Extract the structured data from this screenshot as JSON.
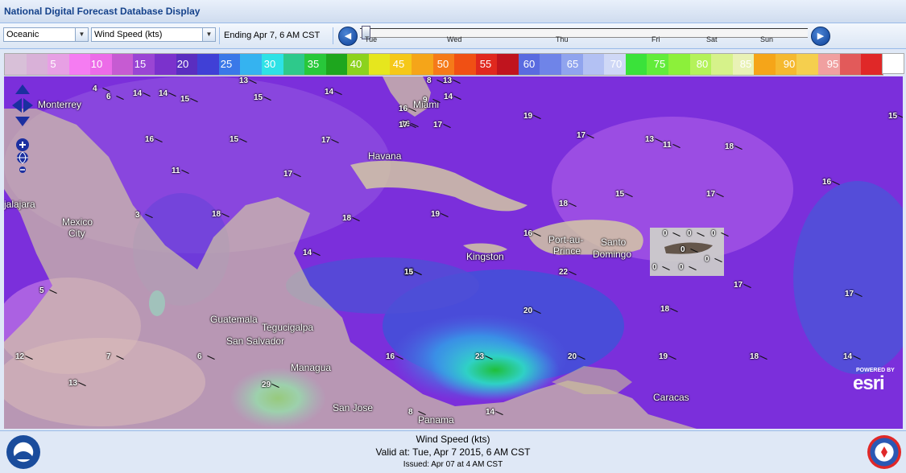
{
  "app": {
    "title": "National Digital Forecast Database Display"
  },
  "toolbar": {
    "region_select": "Oceanic",
    "element_select": "Wind Speed (kts)",
    "ending_label": "Ending Apr  7,  6 AM CST",
    "prev_icon": "step-back-icon",
    "next_icon": "step-forward-icon"
  },
  "timeline": {
    "days": [
      "Tue",
      "Wed",
      "Thu",
      "Fri",
      "Sat",
      "Sun"
    ],
    "position": 0.0
  },
  "legend": {
    "labels": [
      "5",
      "10",
      "15",
      "20",
      "25",
      "30",
      "35",
      "40",
      "45",
      "50",
      "55",
      "60",
      "65",
      "70",
      "75",
      "80",
      "85",
      "90",
      "95"
    ],
    "colors": [
      "#d8c0d8",
      "#d9b1d8",
      "#e7a0e4",
      "#f57cf2",
      "#ec6be8",
      "#c65bd2",
      "#9a45d4",
      "#7b32cc",
      "#5a2ec0",
      "#4040d6",
      "#3a78e8",
      "#35b3f0",
      "#2ee2e6",
      "#2ec98b",
      "#28c83a",
      "#1ea61e",
      "#8cd21e",
      "#e6e61e",
      "#f5c819",
      "#f5a519",
      "#f57a19",
      "#f05014",
      "#e0281e",
      "#c0141e",
      "#5a6be0",
      "#6f84e8",
      "#90a4ee",
      "#b3c1f3",
      "#cfd8f6",
      "#3ae23a",
      "#62ec3a",
      "#8cf03a",
      "#b4f25a",
      "#d6f28a",
      "#e9f2b6",
      "#f5a519",
      "#f5b930",
      "#f5cf4e",
      "#f0a0a0",
      "#e25a5a",
      "#e02828"
    ]
  },
  "map": {
    "places": [
      "Monterrey",
      "Mexico",
      "City",
      "jalajara",
      "Havana",
      "Miami",
      "Kingston",
      "Port-au-",
      "Prince",
      "Santo",
      "Domingo",
      "Guatemala",
      "Tegucigalpa",
      "San Salvador",
      "Managua",
      "San Jose",
      "Panama",
      "Caracas"
    ],
    "wind_barbs": [
      "4",
      "6",
      "14",
      "14",
      "15",
      "13",
      "15",
      "14",
      "8",
      "13",
      "16",
      "9",
      "14",
      "16",
      "17",
      "17",
      "19",
      "17",
      "13",
      "11",
      "15",
      "16",
      "15",
      "17",
      "18",
      "11",
      "17",
      "16",
      "17",
      "3",
      "18",
      "18",
      "19",
      "18",
      "15",
      "16",
      "14",
      "14",
      "5",
      "14",
      "15",
      "22",
      "17",
      "17",
      "20",
      "18",
      "12",
      "7",
      "6",
      "16",
      "23",
      "20",
      "19",
      "18",
      "14",
      "13",
      "29",
      "8",
      "14",
      "0",
      "0",
      "0",
      "0",
      "0",
      "0",
      "0"
    ],
    "attribution": {
      "powered_by": "POWERED BY",
      "brand": "esri"
    }
  },
  "footer": {
    "title": "Wind Speed (kts)",
    "valid": "Valid at: Tue, Apr   7 2015,    6 AM CST",
    "issued": "Issued: Apr 07 at 4 AM CST",
    "left_logo": "noaa-logo-icon",
    "right_logo": "nws-logo-icon"
  }
}
